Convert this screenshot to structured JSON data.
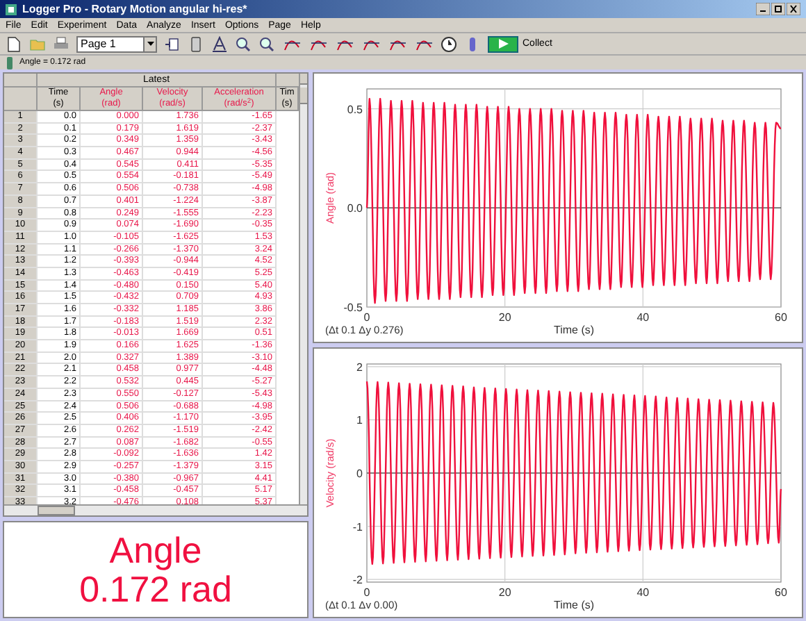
{
  "window": {
    "title": "Logger Pro - Rotary Motion angular hi-res*"
  },
  "menu": [
    "File",
    "Edit",
    "Experiment",
    "Data",
    "Analyze",
    "Insert",
    "Options",
    "Page",
    "Help"
  ],
  "toolbar": {
    "page_select": "Page 1",
    "collect_button": "Collect"
  },
  "status": {
    "text": "Angle = 0.172 rad"
  },
  "table": {
    "group_header": "Latest",
    "columns": [
      {
        "name": "Time",
        "unit": "(s)",
        "color": "#000000"
      },
      {
        "name": "Angle",
        "unit": "(rad)",
        "color": "#e8174a"
      },
      {
        "name": "Velocity",
        "unit": "(rad/s)",
        "color": "#e8174a"
      },
      {
        "name": "Acceleration",
        "unit": "(rad/s$^{2}$)",
        "color": "#e8174a"
      },
      {
        "name": "Tim",
        "unit": "(s)",
        "color": "#000000"
      }
    ],
    "rows": [
      [
        "1",
        "0.0",
        "0.000",
        "1.736",
        "-1.65"
      ],
      [
        "2",
        "0.1",
        "0.179",
        "1.619",
        "-2.37"
      ],
      [
        "3",
        "0.2",
        "0.349",
        "1.359",
        "-3.43"
      ],
      [
        "4",
        "0.3",
        "0.467",
        "0.944",
        "-4.56"
      ],
      [
        "5",
        "0.4",
        "0.545",
        "0.411",
        "-5.35"
      ],
      [
        "6",
        "0.5",
        "0.554",
        "-0.181",
        "-5.49"
      ],
      [
        "7",
        "0.6",
        "0.506",
        "-0.738",
        "-4.98"
      ],
      [
        "8",
        "0.7",
        "0.401",
        "-1.224",
        "-3.87"
      ],
      [
        "9",
        "0.8",
        "0.249",
        "-1.555",
        "-2.23"
      ],
      [
        "10",
        "0.9",
        "0.074",
        "-1.690",
        "-0.35"
      ],
      [
        "11",
        "1.0",
        "-0.105",
        "-1.625",
        "1.53"
      ],
      [
        "12",
        "1.1",
        "-0.266",
        "-1.370",
        "3.24"
      ],
      [
        "13",
        "1.2",
        "-0.393",
        "-0.944",
        "4.52"
      ],
      [
        "14",
        "1.3",
        "-0.463",
        "-0.419",
        "5.25"
      ],
      [
        "15",
        "1.4",
        "-0.480",
        "0.150",
        "5.40"
      ],
      [
        "16",
        "1.5",
        "-0.432",
        "0.709",
        "4.93"
      ],
      [
        "17",
        "1.6",
        "-0.332",
        "1.185",
        "3.86"
      ],
      [
        "18",
        "1.7",
        "-0.183",
        "1.519",
        "2.32"
      ],
      [
        "19",
        "1.8",
        "-0.013",
        "1.669",
        "0.51"
      ],
      [
        "20",
        "1.9",
        "0.166",
        "1.625",
        "-1.36"
      ],
      [
        "21",
        "2.0",
        "0.327",
        "1.389",
        "-3.10"
      ],
      [
        "22",
        "2.1",
        "0.458",
        "0.977",
        "-4.48"
      ],
      [
        "23",
        "2.2",
        "0.532",
        "0.445",
        "-5.27"
      ],
      [
        "24",
        "2.3",
        "0.550",
        "-0.127",
        "-5.43"
      ],
      [
        "25",
        "2.4",
        "0.506",
        "-0.688",
        "-4.98"
      ],
      [
        "26",
        "2.5",
        "0.406",
        "-1.170",
        "-3.95"
      ],
      [
        "27",
        "2.6",
        "0.262",
        "-1.519",
        "-2.42"
      ],
      [
        "28",
        "2.7",
        "0.087",
        "-1.682",
        "-0.55"
      ],
      [
        "29",
        "2.8",
        "-0.092",
        "-1.636",
        "1.42"
      ],
      [
        "30",
        "2.9",
        "-0.257",
        "-1.379",
        "3.15"
      ],
      [
        "31",
        "3.0",
        "-0.380",
        "-0.967",
        "4.41"
      ],
      [
        "32",
        "3.1",
        "-0.458",
        "-0.457",
        "5.17"
      ],
      [
        "33",
        "3.2",
        "-0.476",
        "0.108",
        "5.37"
      ]
    ]
  },
  "meter": {
    "label": "Angle",
    "reading": "0.172 rad"
  },
  "graphs": [
    {
      "chart_data": {
        "type": "line",
        "grid": true,
        "xlabel": "Time (s)",
        "ylabel": "Angle (rad)",
        "xlim": [
          0,
          60
        ],
        "ylim": [
          -0.5,
          0.6
        ],
        "xticks": [
          0,
          20,
          40,
          60
        ],
        "yticks": [
          {
            "value": 0.5,
            "label": "0.5"
          },
          {
            "value": 0,
            "label": "0.0"
          },
          {
            "value": -0.5,
            "label": "-0.5"
          }
        ],
        "x": [
          0,
          0.39,
          1.17,
          1.94,
          2.72,
          3.49,
          4.27,
          5.04,
          5.82,
          6.59,
          7.37,
          8.14,
          8.92,
          9.69,
          10.47,
          11.24,
          12.02,
          12.79,
          13.57,
          14.34,
          15.12,
          15.89,
          16.67,
          17.44,
          18.22,
          18.99,
          19.77,
          20.54,
          21.32,
          22.09,
          22.87,
          23.64,
          24.42,
          25.19,
          25.97,
          26.74,
          27.52,
          28.29,
          29.07,
          29.84,
          30.62,
          31.39,
          32.17,
          32.94,
          33.72,
          34.49,
          35.27,
          36.04,
          36.82,
          37.59,
          38.37,
          39.14,
          39.92,
          40.69,
          41.47,
          42.24,
          43.02,
          43.79,
          44.57,
          45.34,
          46.12,
          46.89,
          47.67,
          48.44,
          49.22,
          49.99,
          50.77,
          51.54,
          52.32,
          53.09,
          53.87,
          54.64,
          55.42,
          56.19,
          56.97,
          57.74,
          58.52,
          59.29,
          60
        ],
        "series": [
          {
            "color": "#f0103c",
            "values": [
              0,
              0.55,
              -0.48,
              0.55,
              -0.47,
              0.54,
              -0.47,
              0.54,
              -0.47,
              0.54,
              -0.46,
              0.53,
              -0.46,
              0.53,
              -0.46,
              0.53,
              -0.46,
              0.52,
              -0.45,
              0.52,
              -0.45,
              0.52,
              -0.45,
              0.51,
              -0.44,
              0.51,
              -0.44,
              0.51,
              -0.44,
              0.5,
              -0.43,
              0.5,
              -0.43,
              0.5,
              -0.43,
              0.5,
              -0.42,
              0.49,
              -0.42,
              0.49,
              -0.42,
              0.49,
              -0.41,
              0.48,
              -0.41,
              0.48,
              -0.41,
              0.48,
              -0.4,
              0.47,
              -0.4,
              0.47,
              -0.4,
              0.47,
              -0.39,
              0.46,
              -0.39,
              0.46,
              -0.39,
              0.46,
              -0.39,
              0.45,
              -0.38,
              0.45,
              -0.38,
              0.45,
              -0.38,
              0.44,
              -0.37,
              0.44,
              -0.37,
              0.44,
              -0.37,
              0.43,
              -0.36,
              0.43,
              -0.36,
              0.43,
              0.4
            ]
          }
        ]
      },
      "readout": "(Δt 0.1  Δy 0.276)"
    },
    {
      "chart_data": {
        "type": "line",
        "grid": true,
        "xlabel": "Time (s)",
        "ylabel": "Velocity (rad/s)",
        "xlim": [
          0,
          60
        ],
        "ylim": [
          -2.05,
          2.05
        ],
        "xticks": [
          0,
          20,
          40,
          60
        ],
        "yticks": [
          2,
          1,
          0,
          -1,
          -2
        ],
        "x": [
          0,
          0.78,
          1.55,
          2.33,
          3.1,
          3.88,
          4.65,
          5.43,
          6.2,
          6.98,
          7.75,
          8.53,
          9.3,
          10.08,
          10.85,
          11.63,
          12.4,
          13.18,
          13.95,
          14.73,
          15.5,
          16.28,
          17.05,
          17.83,
          18.6,
          19.38,
          20.15,
          20.93,
          21.7,
          22.48,
          23.25,
          24.03,
          24.8,
          25.58,
          26.35,
          27.13,
          27.9,
          28.68,
          29.45,
          30.23,
          31.0,
          31.78,
          32.55,
          33.33,
          34.1,
          34.88,
          35.65,
          36.43,
          37.2,
          37.98,
          38.75,
          39.53,
          40.3,
          41.08,
          41.85,
          42.63,
          43.4,
          44.18,
          44.95,
          45.73,
          46.5,
          47.28,
          48.05,
          48.83,
          49.6,
          50.38,
          51.15,
          51.93,
          52.7,
          53.48,
          54.25,
          55.03,
          55.8,
          56.58,
          57.35,
          58.13,
          58.9,
          59.68,
          60
        ],
        "series": [
          {
            "color": "#f0103c",
            "values": [
              1.72,
              -1.71,
              1.71,
              -1.7,
              1.7,
              -1.69,
              1.69,
              -1.68,
              1.68,
              -1.67,
              1.67,
              -1.66,
              1.66,
              -1.65,
              1.65,
              -1.64,
              1.64,
              -1.63,
              1.63,
              -1.62,
              1.61,
              -1.61,
              1.6,
              -1.6,
              1.59,
              -1.59,
              1.58,
              -1.58,
              1.57,
              -1.57,
              1.56,
              -1.56,
              1.55,
              -1.55,
              1.54,
              -1.54,
              1.53,
              -1.53,
              1.52,
              -1.51,
              1.51,
              -1.5,
              1.5,
              -1.49,
              1.49,
              -1.48,
              1.48,
              -1.47,
              1.47,
              -1.46,
              1.46,
              -1.45,
              1.45,
              -1.44,
              1.44,
              -1.43,
              1.42,
              -1.42,
              1.41,
              -1.41,
              1.4,
              -1.4,
              1.39,
              -1.39,
              1.38,
              -1.38,
              1.37,
              -1.37,
              1.36,
              -1.36,
              1.35,
              -1.35,
              1.34,
              -1.34,
              1.33,
              -1.32,
              1.32,
              -1.31,
              -0.3
            ]
          }
        ]
      },
      "readout": "(Δt 0.1  Δv 0.00)"
    }
  ]
}
